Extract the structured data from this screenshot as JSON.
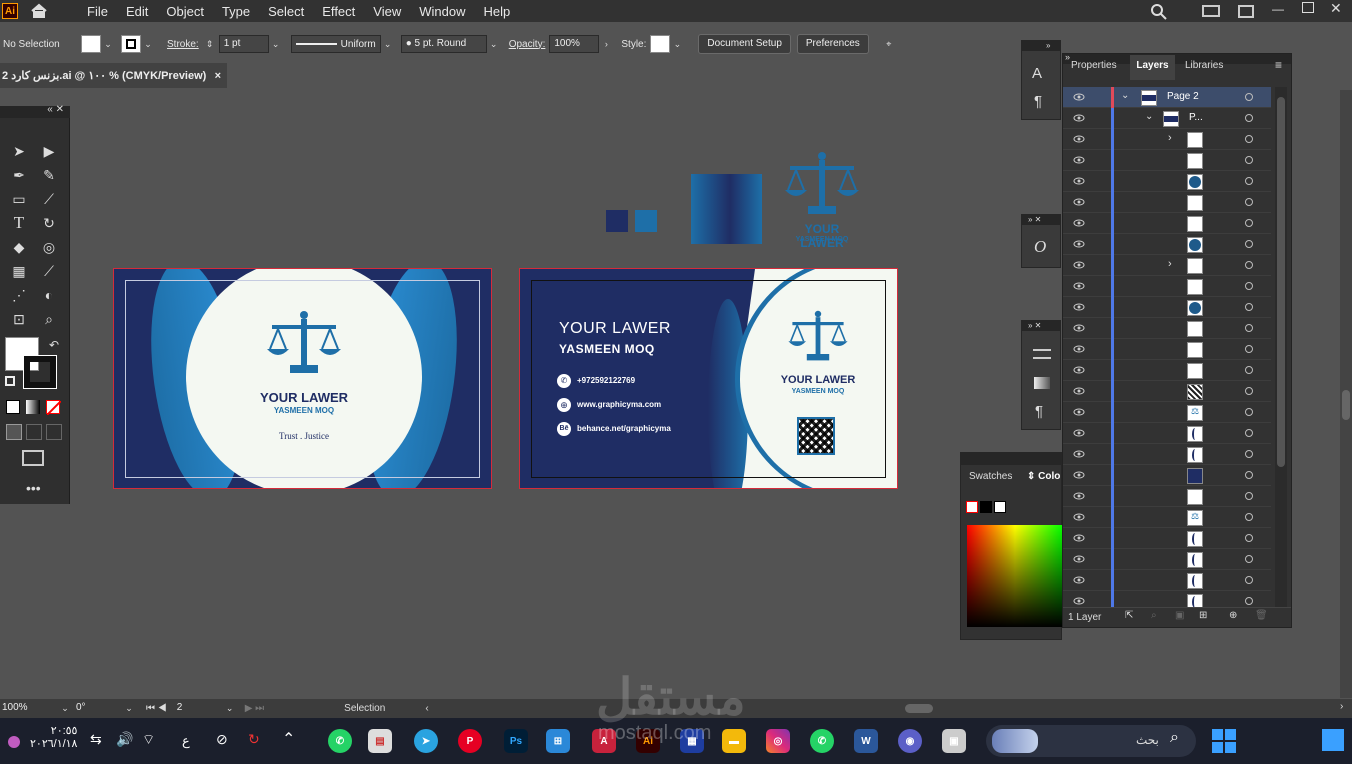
{
  "menubar": {
    "app_icon": "Ai",
    "items": [
      "File",
      "Edit",
      "Object",
      "Type",
      "Select",
      "Effect",
      "View",
      "Window",
      "Help"
    ]
  },
  "control": {
    "selection": "No Selection",
    "stroke_label": "Stroke:",
    "stroke_value": "1 pt",
    "profile": "Uniform",
    "brush": "5 pt. Round",
    "opacity_label": "Opacity:",
    "opacity_value": "100%",
    "style_label": "Style:",
    "doc_setup": "Document Setup",
    "preferences": "Preferences"
  },
  "doc_tab": {
    "title": "2 بزنس كارد.ai @ ١٠٠ % (CMYK/Preview)",
    "close": "×"
  },
  "front_card": {
    "title": "YOUR LAWER",
    "name": "YASMEEN MOQ",
    "tagline": "Trust . Justice"
  },
  "back_card": {
    "title": "YOUR LAWER",
    "name": "YASMEEN MOQ",
    "phone": "+972592122769",
    "web": "www.graphicyma.com",
    "behance": "behance.net/graphicyma",
    "logo_title": "YOUR LAWER",
    "logo_name": "YASMEEN MOQ"
  },
  "logo_sample": {
    "title": "YOUR LAWER",
    "name": "YASMEEN MOQ"
  },
  "colors": {
    "navy": "#1f2d64",
    "blue": "#1e6fa8",
    "cream": "#f4f8f2",
    "artboard_border": "#d52b3a"
  },
  "layers_panel": {
    "tabs": [
      "Properties",
      "Layers",
      "Libraries"
    ],
    "page2": "Page 2",
    "sub": "P...",
    "footer": "1 Layer"
  },
  "swatches_panel": {
    "tabs": [
      "Swatches",
      "Colo"
    ]
  },
  "status": {
    "zoom": "100%",
    "rotation": "0°",
    "artboard": "2",
    "tool": "Selection"
  },
  "taskbar": {
    "time": "٢٠:٥٥",
    "date": "٢٠٢٦/١/١٨",
    "lang": "ع",
    "search": "بحث",
    "watermark": "مستقل",
    "watermark_url": "mostaql.com"
  }
}
